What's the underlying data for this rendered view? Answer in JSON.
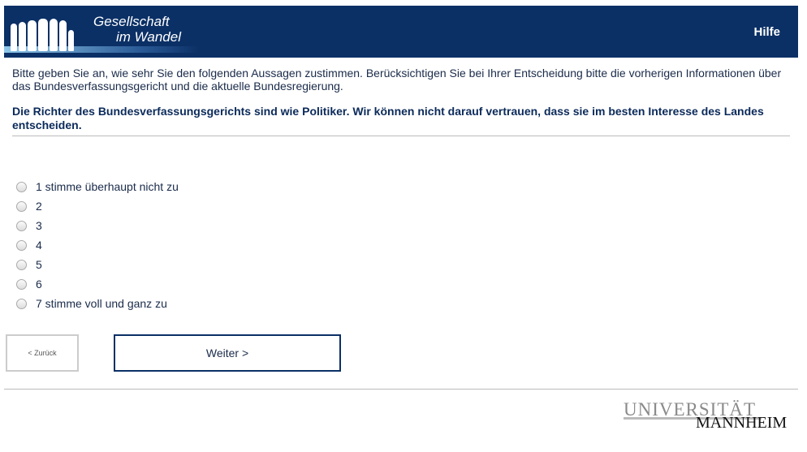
{
  "header": {
    "logo_text_line1": "Gesellschaft",
    "logo_text_line2": "im Wandel",
    "help_label": "Hilfe",
    "bg_color": "#0b3066"
  },
  "intro": "Bitte geben Sie an, wie sehr Sie den folgenden Aussagen zustimmen. Berücksichtigen Sie bei Ihrer Entscheidung bitte die vorherigen Informationen über das Bundesverfassungsgericht und die aktuelle Bundesregierung.",
  "question": "Die Richter des Bundesverfassungsgerichts sind wie Politiker. Wir können nicht darauf vertrauen, dass sie im besten Interesse des Landes entscheiden.",
  "options": [
    {
      "label": "1 stimme überhaupt nicht zu"
    },
    {
      "label": "2"
    },
    {
      "label": "3"
    },
    {
      "label": "4"
    },
    {
      "label": "5"
    },
    {
      "label": "6"
    },
    {
      "label": "7 stimme voll und ganz zu"
    }
  ],
  "nav": {
    "back_label": "< Zurück",
    "next_label": "Weiter >"
  },
  "footer": {
    "logo_line1": "UNIVERSITÄT",
    "logo_line2": "MANNHEIM"
  }
}
